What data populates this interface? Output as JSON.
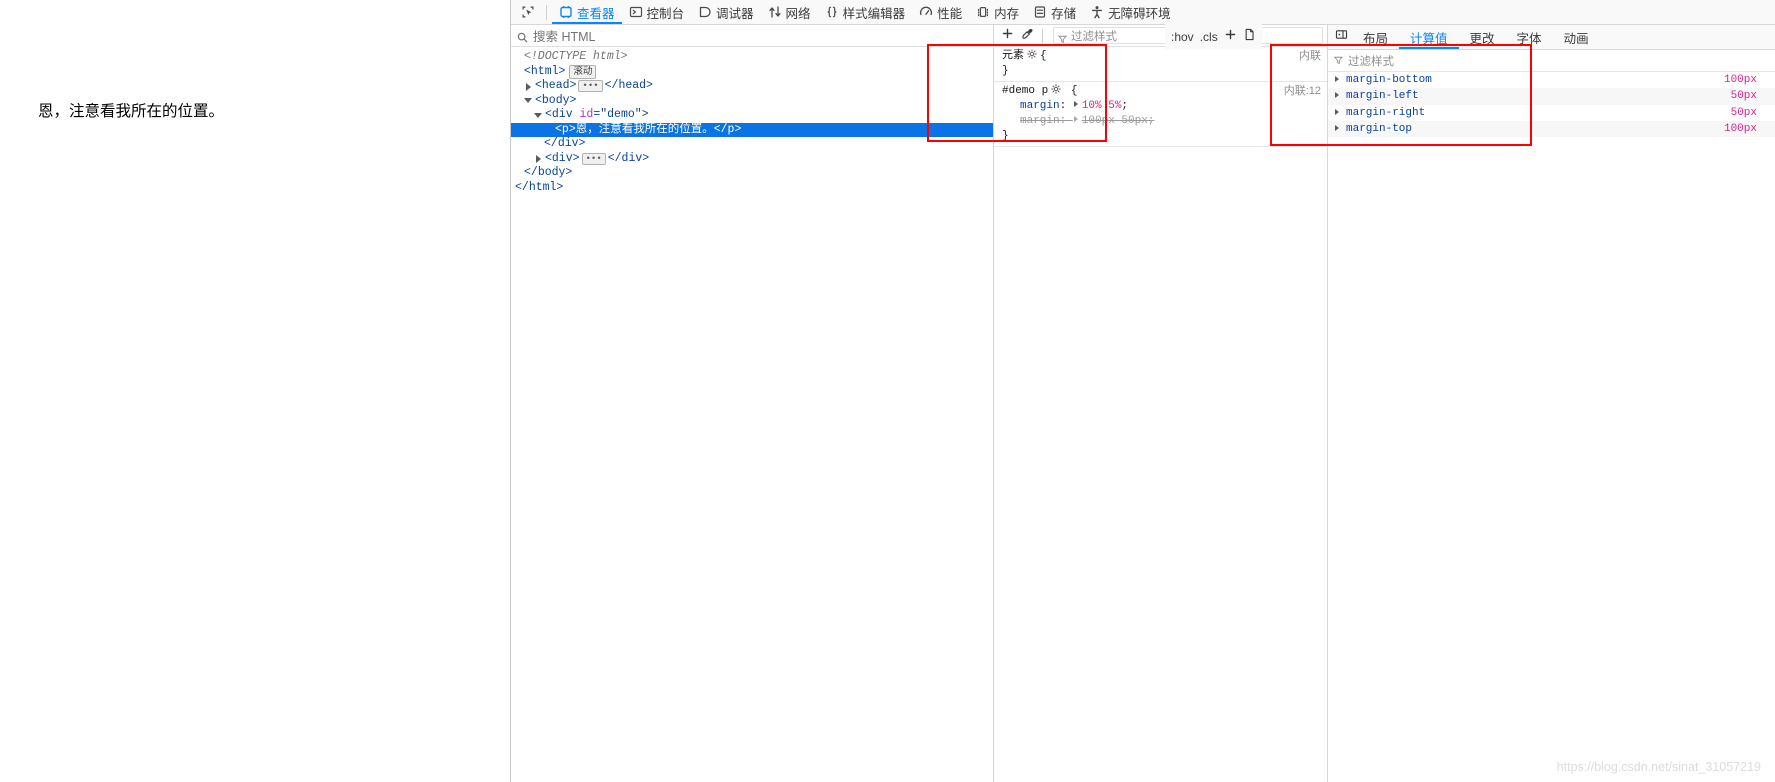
{
  "page": {
    "content_text": "恩，注意看我所在的位置。"
  },
  "toolbar": {
    "picker_icon": "element-picker-icon",
    "items": [
      {
        "label": "查看器",
        "icon": "inspector-icon",
        "active": true
      },
      {
        "label": "控制台",
        "icon": "console-icon",
        "active": false
      },
      {
        "label": "调试器",
        "icon": "debugger-icon",
        "active": false
      },
      {
        "label": "网络",
        "icon": "network-icon",
        "active": false
      },
      {
        "label": "样式编辑器",
        "icon": "style-editor-icon",
        "active": false
      },
      {
        "label": "性能",
        "icon": "performance-icon",
        "active": false
      },
      {
        "label": "内存",
        "icon": "memory-icon",
        "active": false
      },
      {
        "label": "存储",
        "icon": "storage-icon",
        "active": false
      },
      {
        "label": "无障碍环境",
        "icon": "accessibility-icon",
        "active": false
      }
    ]
  },
  "markup": {
    "search_placeholder": "搜索 HTML",
    "search_icon": "search-icon",
    "tree": [
      {
        "indent": 0,
        "twisty": "none",
        "type": "doctype",
        "text": "<!DOCTYPE html>"
      },
      {
        "indent": 0,
        "twisty": "none",
        "type": "open",
        "tag": "html",
        "badge": "滚动"
      },
      {
        "indent": 0,
        "twisty": "closed",
        "type": "collapsed",
        "tag": "head"
      },
      {
        "indent": 0,
        "twisty": "open",
        "type": "open",
        "tag": "body"
      },
      {
        "indent": 1,
        "twisty": "open",
        "type": "open",
        "tag": "div",
        "attr_name": "id",
        "attr_value": "\"demo\""
      },
      {
        "indent": 2,
        "twisty": "none",
        "type": "textnode",
        "tag": "p",
        "text": "恩，注意看我所在的位置。",
        "selected": true
      },
      {
        "indent": 1,
        "twisty": "none",
        "type": "close",
        "tag": "div"
      },
      {
        "indent": 1,
        "twisty": "closed",
        "type": "collapsed",
        "tag": "div"
      },
      {
        "indent": 0,
        "twisty": "none",
        "type": "close",
        "tag": "body"
      },
      {
        "indent": 0,
        "twisty": "none",
        "type": "close",
        "tag": "html"
      }
    ]
  },
  "rules": {
    "filter_placeholder": "过滤样式",
    "filter_icon": "funnel-icon",
    "add_rule_icon": "plus-icon",
    "color_picker_icon": "eyedropper-icon",
    "blocks": [
      {
        "selector": "元素",
        "origin": "内联",
        "declarations": []
      },
      {
        "selector": "#demo p",
        "origin": "内联:12",
        "declarations": [
          {
            "property": "margin",
            "value": "10% 5%",
            "overridden": false
          },
          {
            "property": "margin",
            "value": "100px 50px",
            "overridden": true
          }
        ]
      }
    ]
  },
  "computed": {
    "panel_toggle_icon": "split-view-icon",
    "tabs": [
      {
        "label": "布局",
        "active": false
      },
      {
        "label": "计算值",
        "active": true
      },
      {
        "label": "更改",
        "active": false
      },
      {
        "label": "字体",
        "active": false
      },
      {
        "label": "动画",
        "active": false
      }
    ],
    "filter_placeholder": "过滤样式",
    "filter_icon": "funnel-icon",
    "properties": [
      {
        "name": "margin-bottom",
        "value": "100px"
      },
      {
        "name": "margin-left",
        "value": "50px"
      },
      {
        "name": "margin-right",
        "value": "50px"
      },
      {
        "name": "margin-top",
        "value": "100px"
      }
    ]
  },
  "pseudo": {
    "hov_label": ":hov",
    "cls_label": ".cls",
    "add_icon": "plus-icon",
    "print_icon": "document-icon"
  },
  "watermark": {
    "text": "https://blog.csdn.net/sinat_31057219"
  },
  "colors": {
    "accent": "#0a84ff",
    "selection": "#0a74e6",
    "annotation": "#ff0000",
    "property": "#0842a0",
    "value": "#e0218a"
  }
}
